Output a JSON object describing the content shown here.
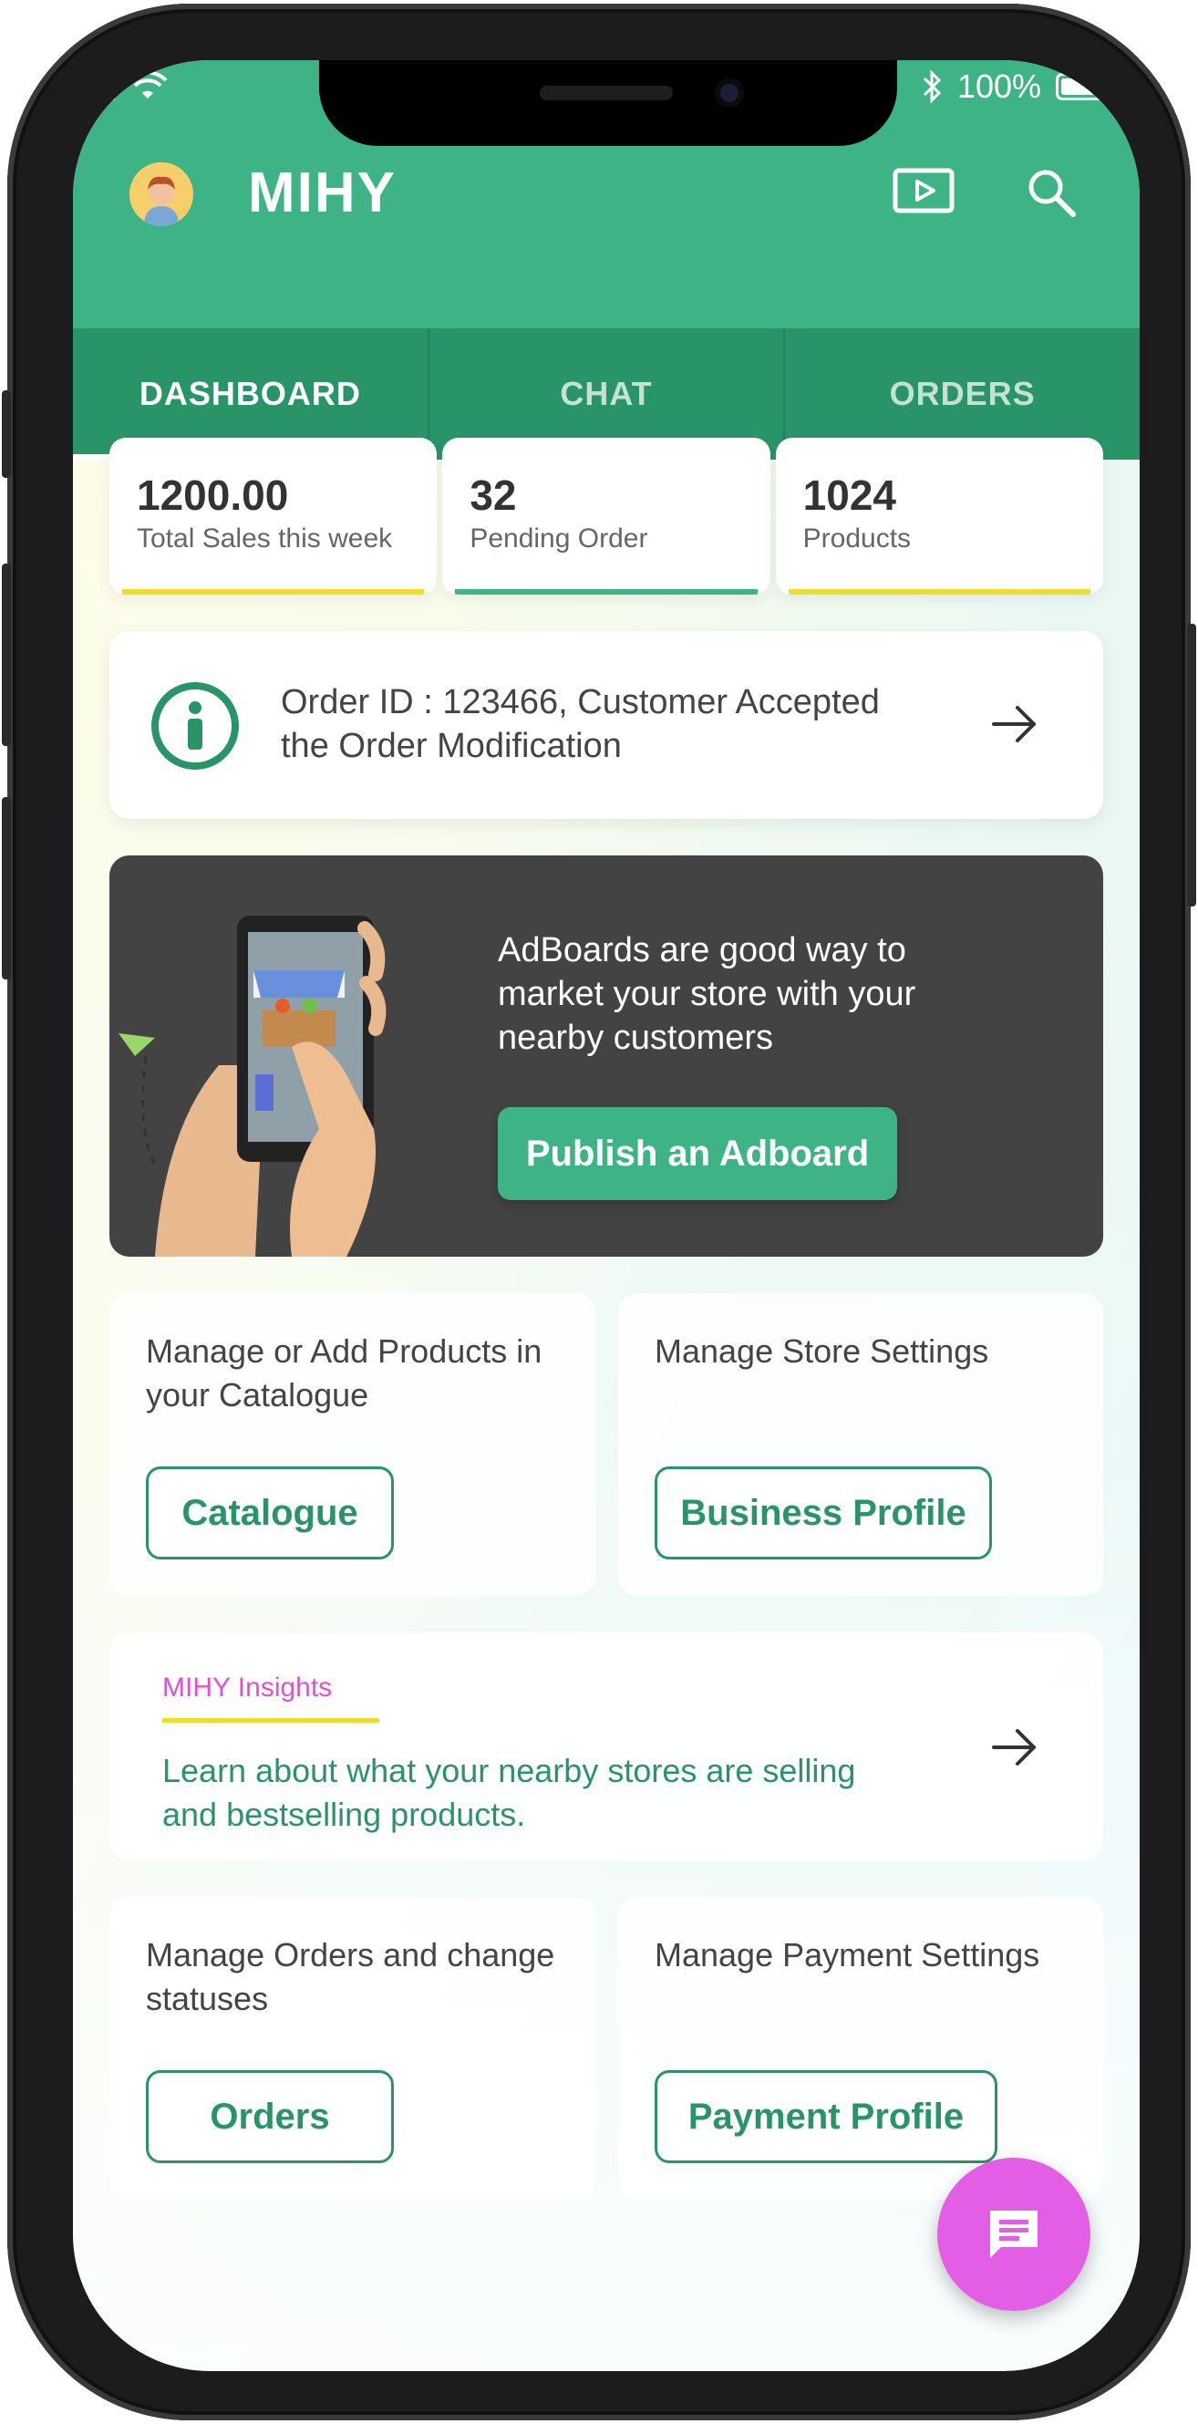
{
  "status_bar": {
    "signal": "▐▐",
    "battery_text": "100%"
  },
  "header": {
    "app_name": "MIHY"
  },
  "tabs": [
    {
      "label": "DASHBOARD",
      "active": true
    },
    {
      "label": "CHAT",
      "active": false
    },
    {
      "label": "ORDERS",
      "active": false
    }
  ],
  "stats": [
    {
      "value": "1200.00",
      "label": "Total Sales this week",
      "accent": "#f0dc2a"
    },
    {
      "value": "32",
      "label": "Pending Order",
      "accent": "#3db386"
    },
    {
      "value": "1024",
      "label": "Products",
      "accent": "#f0dc2a"
    }
  ],
  "notification": {
    "text": "Order ID : 123466, Customer Accepted the Order Modification"
  },
  "adboard": {
    "text": "AdBoards are good way to market your store with your nearby customers",
    "button_label": "Publish an Adboard"
  },
  "cards": {
    "catalogue": {
      "text": "Manage or Add Products in your Catalogue",
      "button_label": "Catalogue"
    },
    "store": {
      "text": "Manage Store Settings",
      "button_label": "Business Profile"
    },
    "orders": {
      "text": "Manage Orders and change statuses",
      "button_label": "Orders"
    },
    "payment": {
      "text": "Manage Payment Settings",
      "button_label": "Payment Profile"
    }
  },
  "insights": {
    "tag": "MIHY Insights",
    "text": "Learn about what your nearby stores are selling and bestselling products."
  },
  "colors": {
    "primary": "#3db386",
    "primary_dark": "#2a9469",
    "accent_yellow": "#f0dc2a",
    "accent_pink": "#e35ee4",
    "banner_bg": "#434343"
  },
  "icons": {
    "avatar": "avatar",
    "cast": "cast-icon",
    "search": "search-icon",
    "notification": "person-info-icon",
    "arrow": "arrow-right-icon",
    "chat": "chat-icon",
    "bluetooth": "bluetooth-icon",
    "wifi": "wifi-icon",
    "battery": "battery-icon"
  }
}
